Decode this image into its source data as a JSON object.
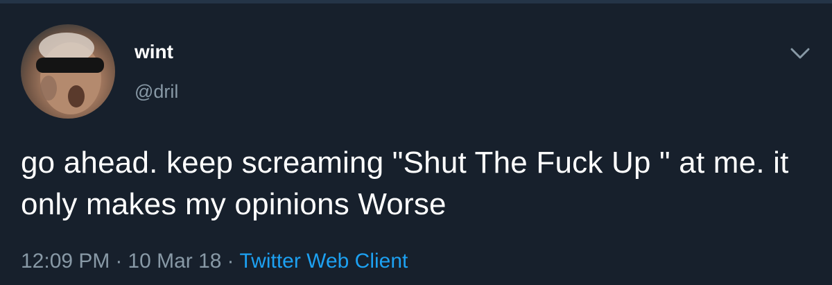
{
  "tweet": {
    "author": {
      "display_name": "wint",
      "handle": "@dril",
      "avatar_icon": "avatar-photo-sunglasses"
    },
    "menu_icon": "chevron-down-icon",
    "text": "go ahead. keep screaming \"Shut The Fuck Up \" at me. it only makes my opinions Worse",
    "meta": {
      "time": "12:09 PM",
      "separator": "·",
      "date": "10 Mar 18",
      "client": "Twitter Web Client"
    }
  },
  "colors": {
    "background": "#17202c",
    "primary_text": "#ffffff",
    "secondary_text": "#8899a6",
    "link": "#1da1f2"
  }
}
